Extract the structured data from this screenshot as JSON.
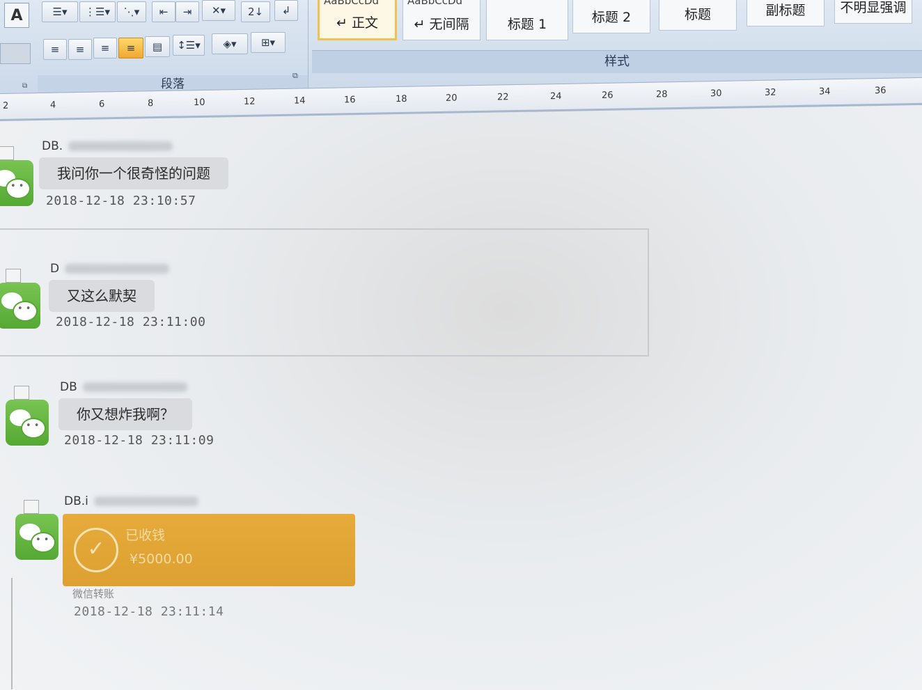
{
  "ribbon": {
    "font_button": "A",
    "paragraph_group_label": "段落",
    "styles_group_label": "样式",
    "styles": [
      {
        "label": "↵ 正文",
        "preview": "AaBbCcDd",
        "selected": true
      },
      {
        "label": "↵ 无间隔",
        "preview": "AaBbCcDd",
        "selected": false
      },
      {
        "label": "标题 1",
        "preview": "",
        "selected": false
      },
      {
        "label": "标题 2",
        "preview": "",
        "selected": false
      },
      {
        "label": "标题",
        "preview": "",
        "selected": false
      },
      {
        "label": "副标题",
        "preview": "",
        "selected": false
      },
      {
        "label": "不明显强调",
        "preview": "",
        "selected": false
      }
    ],
    "sort_label": "2↓",
    "toolbar_row1_icons": [
      "bullet-list-icon",
      "numbered-list-icon",
      "multilevel-list-icon",
      "decrease-indent-icon",
      "increase-indent-icon",
      "chinese-layout-icon",
      "sort-icon",
      "paragraph-mark-icon"
    ],
    "toolbar_row2_icons": [
      "align-left-icon",
      "align-center-icon",
      "align-right-icon",
      "justify-icon",
      "distributed-icon",
      "line-spacing-icon",
      "shading-icon",
      "borders-icon"
    ]
  },
  "ruler": {
    "ticks": [
      "2",
      "4",
      "6",
      "8",
      "10",
      "12",
      "14",
      "16",
      "18",
      "20",
      "22",
      "24",
      "26",
      "28",
      "30",
      "32",
      "34",
      "36"
    ]
  },
  "messages": [
    {
      "sender": "DB.",
      "text": "我问你一个很奇怪的问题",
      "time": "2018-12-18 23:10:57"
    },
    {
      "sender": "D",
      "text": "又这么默契",
      "time": "2018-12-18 23:11:00"
    },
    {
      "sender": "DB",
      "text": "你又想炸我啊？",
      "time": "2018-12-18 23:11:09"
    },
    {
      "sender": "DB.i",
      "time": "2018-12-18 23:11:14"
    }
  ],
  "transfer": {
    "status": "已收钱",
    "amount": "¥5000.00",
    "subtitle": "微信转账"
  },
  "colors": {
    "avatar_green": "#55a834",
    "transfer_orange": "#dda032",
    "bubble_gray": "#d9dbdf"
  }
}
